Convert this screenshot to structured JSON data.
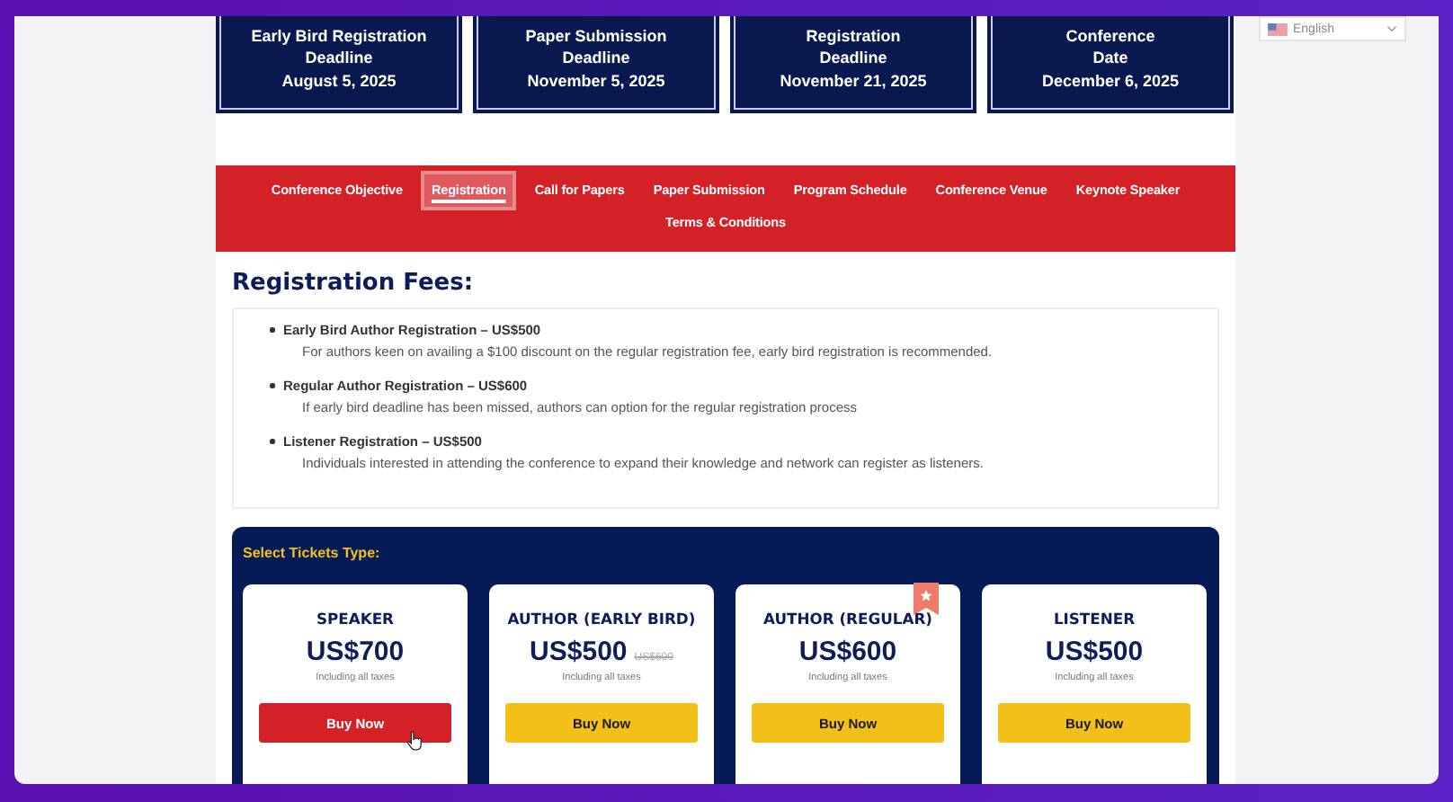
{
  "deadlines": [
    {
      "title": "Early Bird Registration",
      "subtitle": "Deadline",
      "date": "August 5, 2025"
    },
    {
      "title": "Paper Submission",
      "subtitle": "Deadline",
      "date": "November 5, 2025"
    },
    {
      "title": "Registration",
      "subtitle": "Deadline",
      "date": "November 21, 2025"
    },
    {
      "title": "Conference",
      "subtitle": "Date",
      "date": "December 6, 2025"
    }
  ],
  "language_selector": {
    "value": "English"
  },
  "nav": [
    {
      "label": "Conference Objective",
      "selected": false
    },
    {
      "label": "Registration",
      "selected": true
    },
    {
      "label": "Call for Papers",
      "selected": false
    },
    {
      "label": "Paper Submission",
      "selected": false
    },
    {
      "label": "Program Schedule",
      "selected": false
    },
    {
      "label": "Conference Venue",
      "selected": false
    },
    {
      "label": "Keynote Speaker",
      "selected": false
    },
    {
      "label": "Terms & Conditions",
      "selected": false
    }
  ],
  "fees": {
    "title": "Registration Fees:",
    "items": [
      {
        "name": "Early Bird Author Registration – US$500",
        "description": "For authors keen on availing a $100 discount on the regular registration fee, early bird registration is recommended."
      },
      {
        "name": "Regular Author Registration – US$600",
        "description": "If early bird deadline has been missed, authors can option for the regular registration process"
      },
      {
        "name": "Listener Registration – US$500",
        "description": "Individuals interested in attending the conference to expand their knowledge and network can register as listeners."
      }
    ]
  },
  "tickets": {
    "title": "Select Tickets Type:",
    "cards": [
      {
        "name": "SPEAKER",
        "price": "US$700",
        "note": "Including all taxes",
        "button": "Buy Now",
        "highlighted": true,
        "featured": false
      },
      {
        "name": "AUTHOR (EARLY BIRD)",
        "price": "US$500",
        "old_price": "US$600",
        "note": "Including all taxes",
        "button": "Buy Now",
        "highlighted": false,
        "featured": false
      },
      {
        "name": "AUTHOR (REGULAR)",
        "price": "US$600",
        "note": "Including all taxes",
        "button": "Buy Now",
        "highlighted": false,
        "featured": true
      },
      {
        "name": "LISTENER",
        "price": "US$500",
        "note": "Including all taxes",
        "button": "Buy Now",
        "highlighted": false,
        "featured": false
      }
    ]
  }
}
